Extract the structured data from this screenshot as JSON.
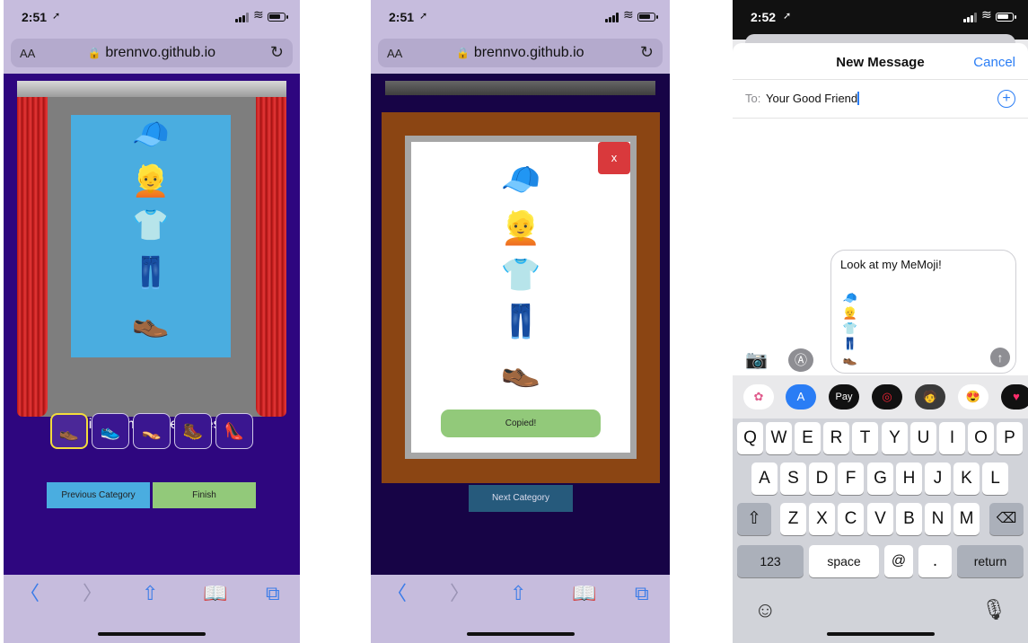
{
  "phone1": {
    "time": "2:51",
    "url": "brennvo.github.io",
    "aa": "AA",
    "outfit": [
      "🧢",
      "👱",
      "👕",
      "👖",
      "👞"
    ],
    "pick_title": "Pick from these shoes:",
    "shoes": [
      "👞",
      "👟",
      "👡",
      "🥾",
      "👠"
    ],
    "prev_label": "Previous Category",
    "finish_label": "Finish"
  },
  "phone2": {
    "time": "2:51",
    "url": "brennvo.github.io",
    "aa": "AA",
    "close_label": "x",
    "outfit": [
      "🧢",
      "👱",
      "👕",
      "👖",
      "👞"
    ],
    "copied_label": "Copied!",
    "next_label": "Next Category"
  },
  "phone3": {
    "time": "2:52",
    "title": "New Message",
    "cancel": "Cancel",
    "to_label": "To:",
    "to_value": "Your Good Friend",
    "bubble_text": "Look at my MeMoji!",
    "bubble_stack": [
      "🧢",
      "👱",
      "👕",
      "👖",
      "👞"
    ],
    "app_applepay": "Pay",
    "keyboard": {
      "row1": [
        "Q",
        "W",
        "E",
        "R",
        "T",
        "Y",
        "U",
        "I",
        "O",
        "P"
      ],
      "row2": [
        "A",
        "S",
        "D",
        "F",
        "G",
        "H",
        "J",
        "K",
        "L"
      ],
      "row3": [
        "Z",
        "X",
        "C",
        "V",
        "B",
        "N",
        "M"
      ],
      "k123": "123",
      "space": "space",
      "at": "@",
      "dot": ".",
      "return": "return"
    }
  },
  "colors": {
    "stage": "#2e067f",
    "card": "#4aade0",
    "frame": "#8b4513",
    "finish": "#92c97a",
    "prev": "#4aade0",
    "close": "#d9393c",
    "ios_blue": "#2a7df5"
  },
  "icons": {
    "toolbar": [
      "chevron-left-icon",
      "chevron-right-icon",
      "share-icon",
      "bookmarks-icon",
      "tabs-icon"
    ],
    "status": [
      "location-arrow-icon",
      "signal-icon",
      "wifi-icon",
      "battery-icon"
    ]
  }
}
